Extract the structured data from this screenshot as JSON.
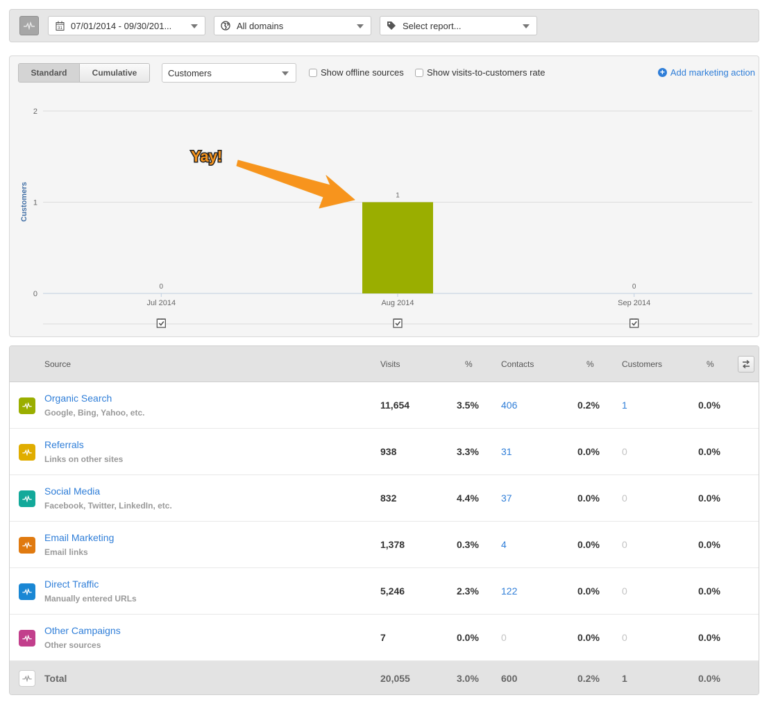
{
  "toolbar": {
    "icon": "sources-pulse-icon",
    "date_range": "07/01/2014 - 09/30/201...",
    "domain": "All domains",
    "report": "Select report..."
  },
  "chart_controls": {
    "view_modes": [
      {
        "label": "Standard",
        "active": true
      },
      {
        "label": "Cumulative",
        "active": false
      }
    ],
    "metric": "Customers",
    "show_offline_sources": {
      "label": "Show offline sources",
      "checked": false
    },
    "show_rate": {
      "label": "Show visits-to-customers rate",
      "checked": false
    },
    "add_action": "Add marketing action"
  },
  "annotation": {
    "text": "Yay!",
    "color": "#f7941d"
  },
  "chart_data": {
    "type": "bar",
    "title": "",
    "xlabel": "",
    "ylabel": "Customers",
    "categories": [
      "Jul 2014",
      "Aug 2014",
      "Sep 2014"
    ],
    "values": [
      0,
      1,
      0
    ],
    "ylim": [
      0,
      2
    ],
    "yticks": [
      0,
      1,
      2
    ],
    "grid": true,
    "bar_color": "#9aae00",
    "legend": "none"
  },
  "table": {
    "headers": {
      "source": "Source",
      "visits": "Visits",
      "visits_pct": "%",
      "contacts": "Contacts",
      "contacts_pct": "%",
      "customers": "Customers",
      "customers_pct": "%"
    },
    "rows": [
      {
        "name": "Organic Search",
        "sub": "Google, Bing, Yahoo, etc.",
        "color": "#9aae00",
        "visits": "11,654",
        "visits_pct": "3.5%",
        "contacts": "406",
        "contacts_pct": "0.2%",
        "customers": "1",
        "customers_pct": "0.0%"
      },
      {
        "name": "Referrals",
        "sub": "Links on other sites",
        "color": "#e0ad00",
        "visits": "938",
        "visits_pct": "3.3%",
        "contacts": "31",
        "contacts_pct": "0.0%",
        "customers": "0",
        "customers_pct": "0.0%"
      },
      {
        "name": "Social Media",
        "sub": "Facebook, Twitter, LinkedIn, etc.",
        "color": "#13a99a",
        "visits": "832",
        "visits_pct": "4.4%",
        "contacts": "37",
        "contacts_pct": "0.0%",
        "customers": "0",
        "customers_pct": "0.0%"
      },
      {
        "name": "Email Marketing",
        "sub": "Email links",
        "color": "#e07a10",
        "visits": "1,378",
        "visits_pct": "0.3%",
        "contacts": "4",
        "contacts_pct": "0.0%",
        "customers": "0",
        "customers_pct": "0.0%"
      },
      {
        "name": "Direct Traffic",
        "sub": "Manually entered URLs",
        "color": "#1a87d4",
        "visits": "5,246",
        "visits_pct": "2.3%",
        "contacts": "122",
        "contacts_pct": "0.0%",
        "customers": "0",
        "customers_pct": "0.0%"
      },
      {
        "name": "Other Campaigns",
        "sub": "Other sources",
        "color": "#c23f8c",
        "visits": "7",
        "visits_pct": "0.0%",
        "contacts": "0",
        "contacts_pct": "0.0%",
        "customers": "0",
        "customers_pct": "0.0%"
      }
    ],
    "total": {
      "name": "Total",
      "visits": "20,055",
      "visits_pct": "3.0%",
      "contacts": "600",
      "contacts_pct": "0.2%",
      "customers": "1",
      "customers_pct": "0.0%"
    }
  }
}
